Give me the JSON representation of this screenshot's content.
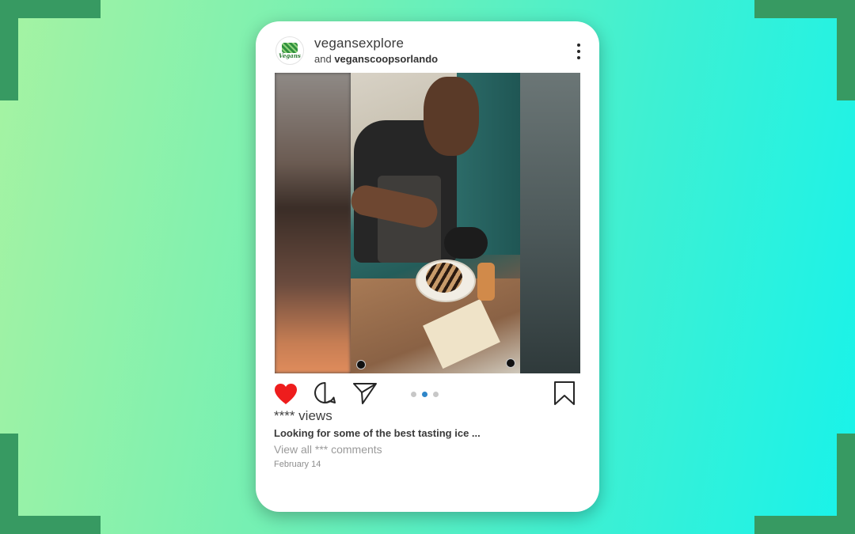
{
  "colors": {
    "background_start": "#a6f3a2",
    "background_end": "#18f3ea",
    "corner_accent": "#379a62",
    "like_red": "#ee1d1d",
    "active_dot": "#2f86c9"
  },
  "post": {
    "avatar_icon": "vegans-explore-logo",
    "avatar_text": "Vegans",
    "username": "vegansexplore",
    "collab_prefix": "and",
    "collab_user": "veganscoopsorlando",
    "more_icon": "vertical-ellipsis-icon",
    "media_description_icon": "video-photo",
    "carousel": {
      "count": 3,
      "active_index": 1
    },
    "actions": {
      "like_icon": "heart-filled-icon",
      "comment_icon": "comment-bubble-icon",
      "share_icon": "paper-plane-icon",
      "save_icon": "bookmark-icon",
      "liked": true
    },
    "views": "**** views",
    "caption": "Looking for some of the best tasting ice ...",
    "comments_link": "View all *** comments",
    "date": "February 14"
  }
}
